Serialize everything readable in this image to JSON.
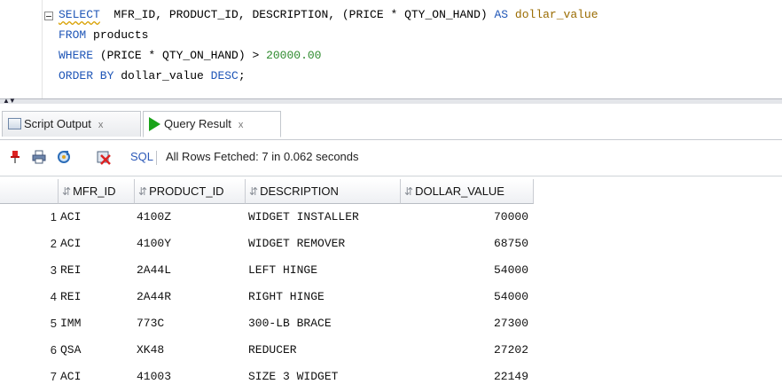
{
  "editor": {
    "lines": [
      {
        "parts": [
          [
            "kw squiggle",
            "SELECT"
          ],
          [
            "",
            "  MFR_ID, PRODUCT_ID, DESCRIPTION, (PRICE * QTY_ON_HAND) "
          ],
          [
            "kw",
            "AS"
          ],
          [
            "alias",
            " dollar_value"
          ]
        ]
      },
      {
        "parts": [
          [
            "kw",
            "FROM"
          ],
          [
            "",
            " products"
          ]
        ]
      },
      {
        "parts": [
          [
            "kw",
            "WHERE"
          ],
          [
            "",
            " (PRICE * QTY_ON_HAND) > "
          ],
          [
            "num",
            "20000.00"
          ]
        ]
      },
      {
        "parts": [
          [
            "kw",
            "ORDER BY"
          ],
          [
            "",
            " dollar_value "
          ],
          [
            "kw",
            "DESC"
          ],
          [
            "",
            ";"
          ]
        ]
      }
    ]
  },
  "tabs": [
    {
      "label": "Script Output",
      "close": "x",
      "icon": "script-output-icon",
      "active": false
    },
    {
      "label": "Query Result",
      "close": "x",
      "icon": "run-query-icon",
      "active": true
    }
  ],
  "toolbar": {
    "sql_label": "SQL",
    "status": "All Rows Fetched: 7 in 0.062 seconds",
    "icons": [
      "pin-icon",
      "print-icon",
      "refresh-icon",
      "clear-icon"
    ]
  },
  "grid": {
    "columns": [
      "MFR_ID",
      "PRODUCT_ID",
      "DESCRIPTION",
      "DOLLAR_VALUE"
    ],
    "rows": [
      {
        "n": "1",
        "mfr": "ACI",
        "pid": "4100Z",
        "desc": "WIDGET INSTALLER",
        "val": "70000"
      },
      {
        "n": "2",
        "mfr": "ACI",
        "pid": "4100Y",
        "desc": "WIDGET REMOVER",
        "val": "68750"
      },
      {
        "n": "3",
        "mfr": "REI",
        "pid": "2A44L",
        "desc": "LEFT HINGE",
        "val": "54000"
      },
      {
        "n": "4",
        "mfr": "REI",
        "pid": "2A44R",
        "desc": "RIGHT HINGE",
        "val": "54000"
      },
      {
        "n": "5",
        "mfr": "IMM",
        "pid": "773C",
        "desc": "300-LB BRACE",
        "val": "27300"
      },
      {
        "n": "6",
        "mfr": "QSA",
        "pid": "XK48",
        "desc": "REDUCER",
        "val": "27202"
      },
      {
        "n": "7",
        "mfr": "ACI",
        "pid": "41003",
        "desc": "SIZE 3 WIDGET",
        "val": "22149"
      }
    ]
  }
}
